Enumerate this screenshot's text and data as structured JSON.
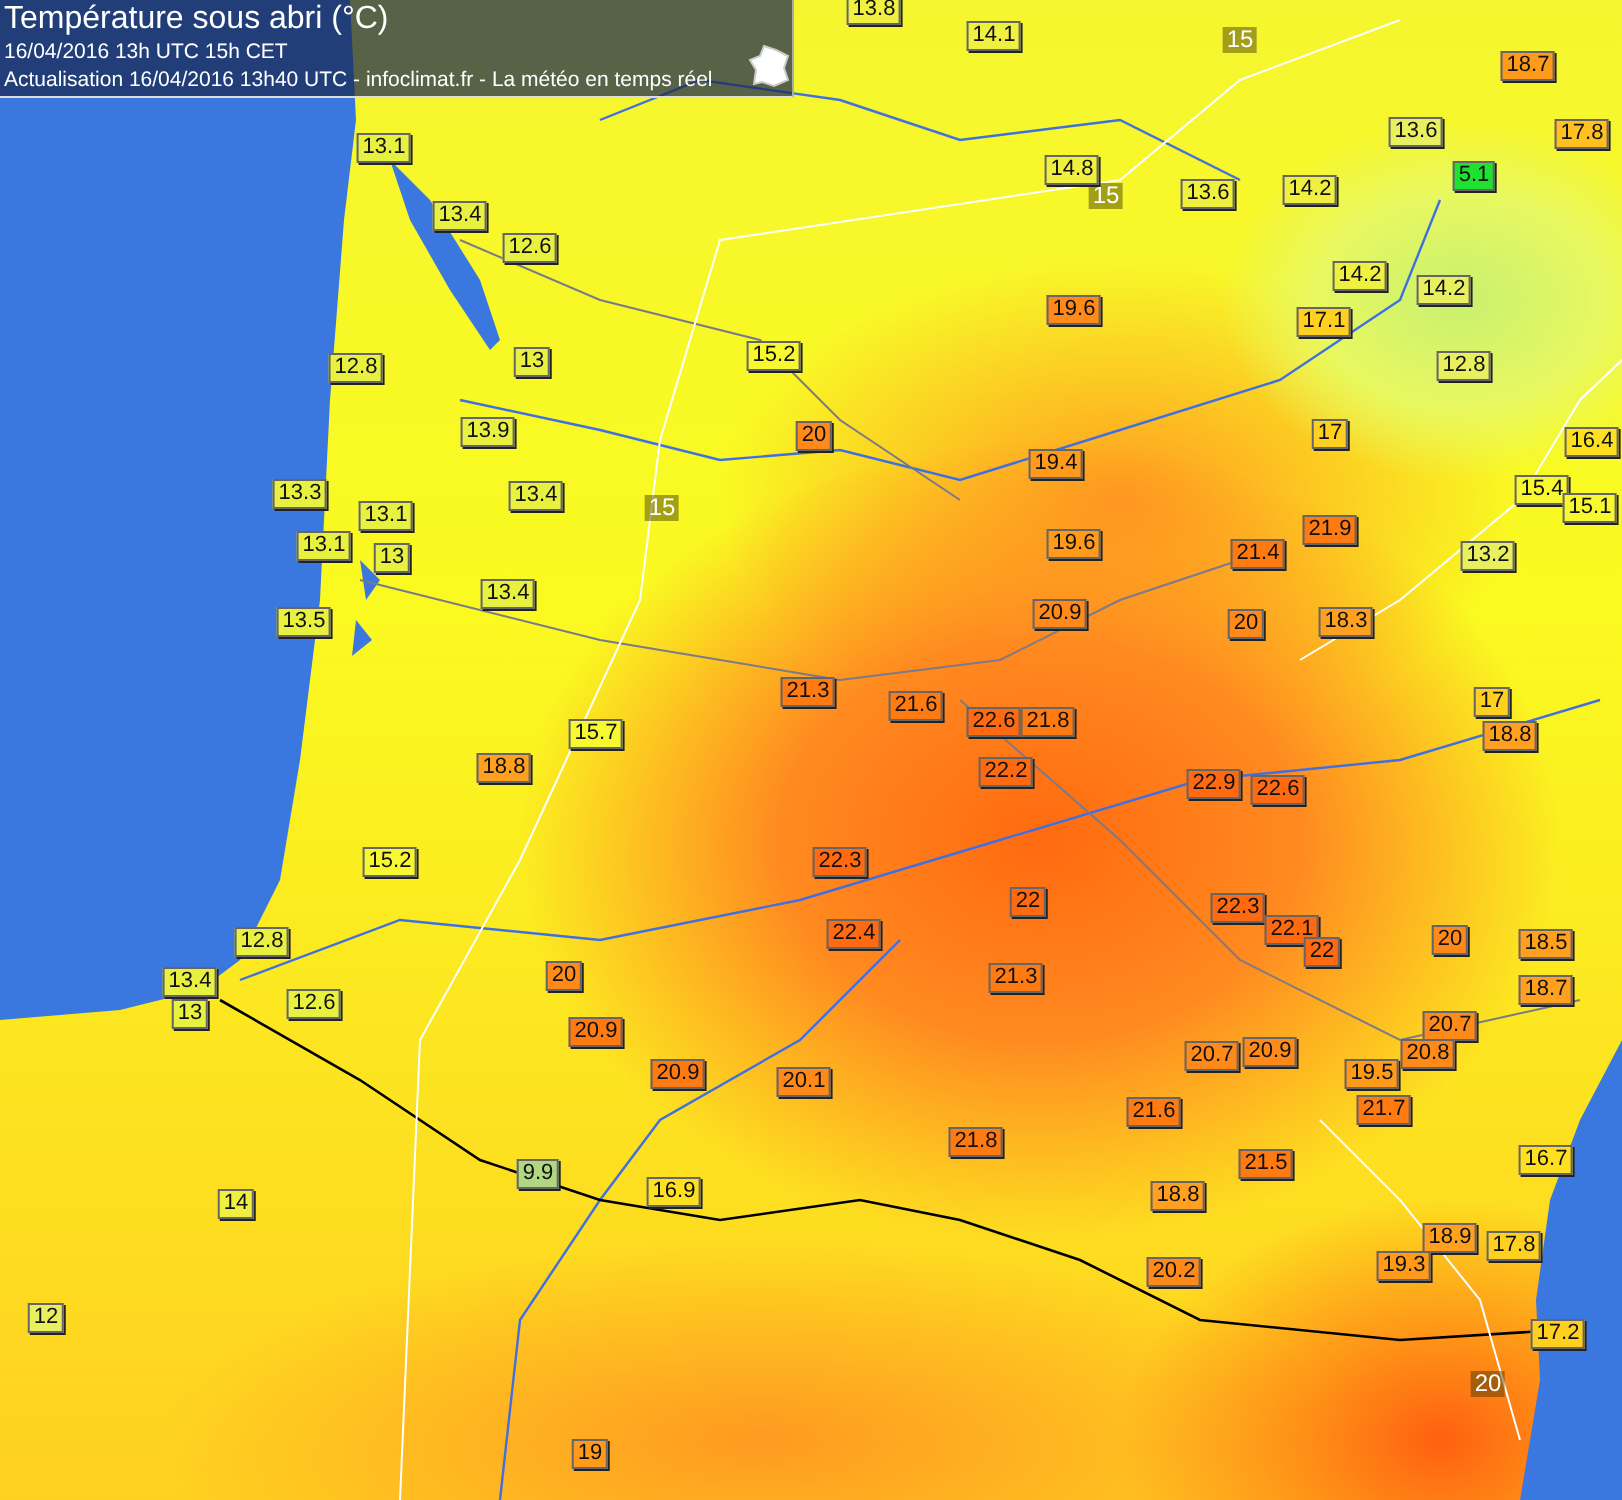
{
  "header": {
    "title": "Température sous abri (°C)",
    "timestamp": "16/04/2016  13h UTC  15h CET",
    "update_line": "Actualisation 16/04/2016 13h40 UTC - infoclimat.fr - La météo en temps réel"
  },
  "stations": [
    {
      "value": "13.8",
      "color": "#f0f040"
    },
    {
      "value": "14.1",
      "color": "#f0f040"
    },
    {
      "value": "18.7",
      "color": "#ff9a1a"
    },
    {
      "value": "13.6",
      "color": "#e8f060"
    },
    {
      "value": "17.8",
      "color": "#ffc020"
    },
    {
      "value": "14.8",
      "color": "#f0f040"
    },
    {
      "value": "13.6",
      "color": "#f0f040"
    },
    {
      "value": "14.2",
      "color": "#f0f040"
    },
    {
      "value": "5.1",
      "color": "#20e030"
    },
    {
      "value": "13.1",
      "color": "#e8f040"
    },
    {
      "value": "13.4",
      "color": "#e8f040"
    },
    {
      "value": "12.6",
      "color": "#e8f040"
    },
    {
      "value": "14.2",
      "color": "#f0f040"
    },
    {
      "value": "14.2",
      "color": "#e8f060"
    },
    {
      "value": "19.6",
      "color": "#ff8a1a"
    },
    {
      "value": "17.1",
      "color": "#ffd020"
    },
    {
      "value": "12.8",
      "color": "#e8f040"
    },
    {
      "value": "13",
      "color": "#e8f040"
    },
    {
      "value": "15.2",
      "color": "#f8f830"
    },
    {
      "value": "12.8",
      "color": "#e8f060"
    },
    {
      "value": "13.9",
      "color": "#e8f040"
    },
    {
      "value": "20",
      "color": "#ff8a1a"
    },
    {
      "value": "17",
      "color": "#ffd020"
    },
    {
      "value": "19.4",
      "color": "#ff9a1a"
    },
    {
      "value": "16.4",
      "color": "#ffe020"
    },
    {
      "value": "13.3",
      "color": "#e8f040"
    },
    {
      "value": "13.4",
      "color": "#e8f040"
    },
    {
      "value": "13.1",
      "color": "#e8f040"
    },
    {
      "value": "15.4",
      "color": "#f8f830"
    },
    {
      "value": "15.1",
      "color": "#f8f830"
    },
    {
      "value": "13.1",
      "color": "#e8f040"
    },
    {
      "value": "13",
      "color": "#e8f040"
    },
    {
      "value": "19.6",
      "color": "#ff9a1a"
    },
    {
      "value": "21.4",
      "color": "#ff7a10"
    },
    {
      "value": "21.9",
      "color": "#ff7a10"
    },
    {
      "value": "13.2",
      "color": "#e8f060"
    },
    {
      "value": "13.4",
      "color": "#e8f040"
    },
    {
      "value": "13.5",
      "color": "#e8f040"
    },
    {
      "value": "20.9",
      "color": "#ff8a1a"
    },
    {
      "value": "20",
      "color": "#ff8a1a"
    },
    {
      "value": "18.3",
      "color": "#ffa020"
    },
    {
      "value": "21.3",
      "color": "#ff7a10"
    },
    {
      "value": "21.6",
      "color": "#ff7a10"
    },
    {
      "value": "22.6",
      "color": "#ff6a10"
    },
    {
      "value": "21.8",
      "color": "#ff7a10"
    },
    {
      "value": "17",
      "color": "#ffd020"
    },
    {
      "value": "18.8",
      "color": "#ffa020"
    },
    {
      "value": "15.7",
      "color": "#f8f830"
    },
    {
      "value": "18.8",
      "color": "#ffa020"
    },
    {
      "value": "22.2",
      "color": "#ff6a10"
    },
    {
      "value": "22.9",
      "color": "#ff6a10"
    },
    {
      "value": "22.6",
      "color": "#ff6a10"
    },
    {
      "value": "15.2",
      "color": "#f8f830"
    },
    {
      "value": "22.3",
      "color": "#ff6a10"
    },
    {
      "value": "22",
      "color": "#ff6a10"
    },
    {
      "value": "22.3",
      "color": "#ff6a10"
    },
    {
      "value": "22.1",
      "color": "#ff6a10"
    },
    {
      "value": "22",
      "color": "#ff6a10"
    },
    {
      "value": "20",
      "color": "#ff8a1a"
    },
    {
      "value": "18.5",
      "color": "#ffa020"
    },
    {
      "value": "22.4",
      "color": "#ff6a10"
    },
    {
      "value": "12.8",
      "color": "#e8f040"
    },
    {
      "value": "13.4",
      "color": "#e8f040"
    },
    {
      "value": "13",
      "color": "#e8f040"
    },
    {
      "value": "12.6",
      "color": "#e8f040"
    },
    {
      "value": "20",
      "color": "#ff8a1a"
    },
    {
      "value": "21.3",
      "color": "#ff7a10"
    },
    {
      "value": "18.7",
      "color": "#ffa020"
    },
    {
      "value": "20.9",
      "color": "#ff7a10"
    },
    {
      "value": "20.7",
      "color": "#ff8a1a"
    },
    {
      "value": "20.9",
      "color": "#ff7a10"
    },
    {
      "value": "20.1",
      "color": "#ff8a1a"
    },
    {
      "value": "20.7",
      "color": "#ff8a1a"
    },
    {
      "value": "20.9",
      "color": "#ff8a1a"
    },
    {
      "value": "19.5",
      "color": "#ff9a1a"
    },
    {
      "value": "20.8",
      "color": "#ff8a1a"
    },
    {
      "value": "21.7",
      "color": "#ff7a10"
    },
    {
      "value": "21.6",
      "color": "#ff7a10"
    },
    {
      "value": "21.8",
      "color": "#ff7a10"
    },
    {
      "value": "21.5",
      "color": "#ff7a10"
    },
    {
      "value": "16.7",
      "color": "#ffe020"
    },
    {
      "value": "9.9",
      "color": "#b0d880"
    },
    {
      "value": "16.9",
      "color": "#ffe020"
    },
    {
      "value": "18.8",
      "color": "#ffa020"
    },
    {
      "value": "14",
      "color": "#f0f040"
    },
    {
      "value": "18.9",
      "color": "#ffa020"
    },
    {
      "value": "17.8",
      "color": "#ffd020"
    },
    {
      "value": "19.3",
      "color": "#ff9a1a"
    },
    {
      "value": "20.2",
      "color": "#ff8a1a"
    },
    {
      "value": "12",
      "color": "#e8f060"
    },
    {
      "value": "17.2",
      "color": "#ffd020"
    },
    {
      "value": "19",
      "color": "#ff9a1a"
    }
  ],
  "isolines": [
    {
      "label": "15"
    },
    {
      "label": "15"
    },
    {
      "label": "15"
    },
    {
      "label": "20"
    }
  ]
}
